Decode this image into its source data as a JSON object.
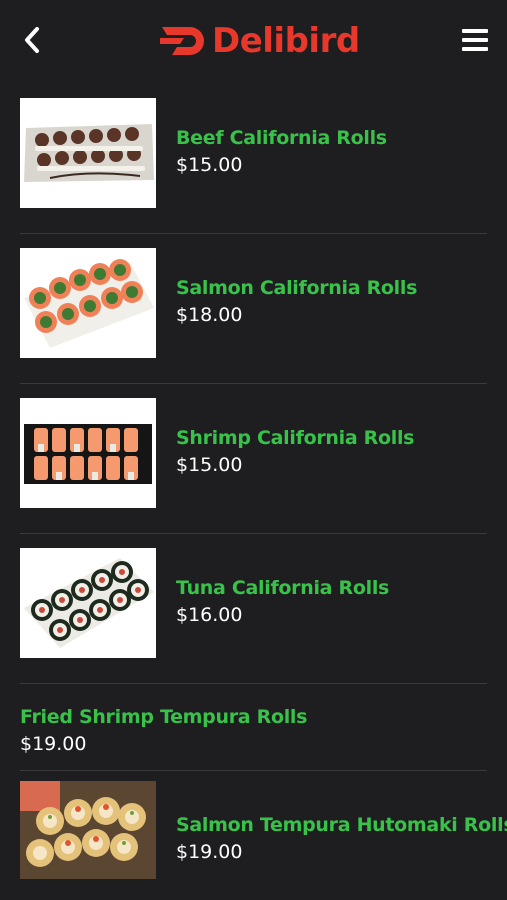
{
  "colors": {
    "background": "#1e1e20",
    "brand_red": "#e8382c",
    "item_name_green": "#38c24a",
    "price_white": "#ffffff",
    "divider": "#3a3a3c"
  },
  "header": {
    "back_icon": "chevron-left-icon",
    "logo_text": "Delibird",
    "menu_icon": "hamburger-menu-icon"
  },
  "menu_items": [
    {
      "name": "Beef California Rolls",
      "price": "$15.00",
      "has_image": true
    },
    {
      "name": "Salmon California Rolls",
      "price": "$18.00",
      "has_image": true
    },
    {
      "name": "Shrimp California Rolls",
      "price": "$15.00",
      "has_image": true
    },
    {
      "name": "Tuna California Rolls",
      "price": "$16.00",
      "has_image": true
    },
    {
      "name": "Fried Shrimp Tempura Rolls",
      "price": "$19.00",
      "has_image": false
    },
    {
      "name": "Salmon Tempura Hutomaki Rolls",
      "price": "$19.00",
      "has_image": true
    }
  ]
}
